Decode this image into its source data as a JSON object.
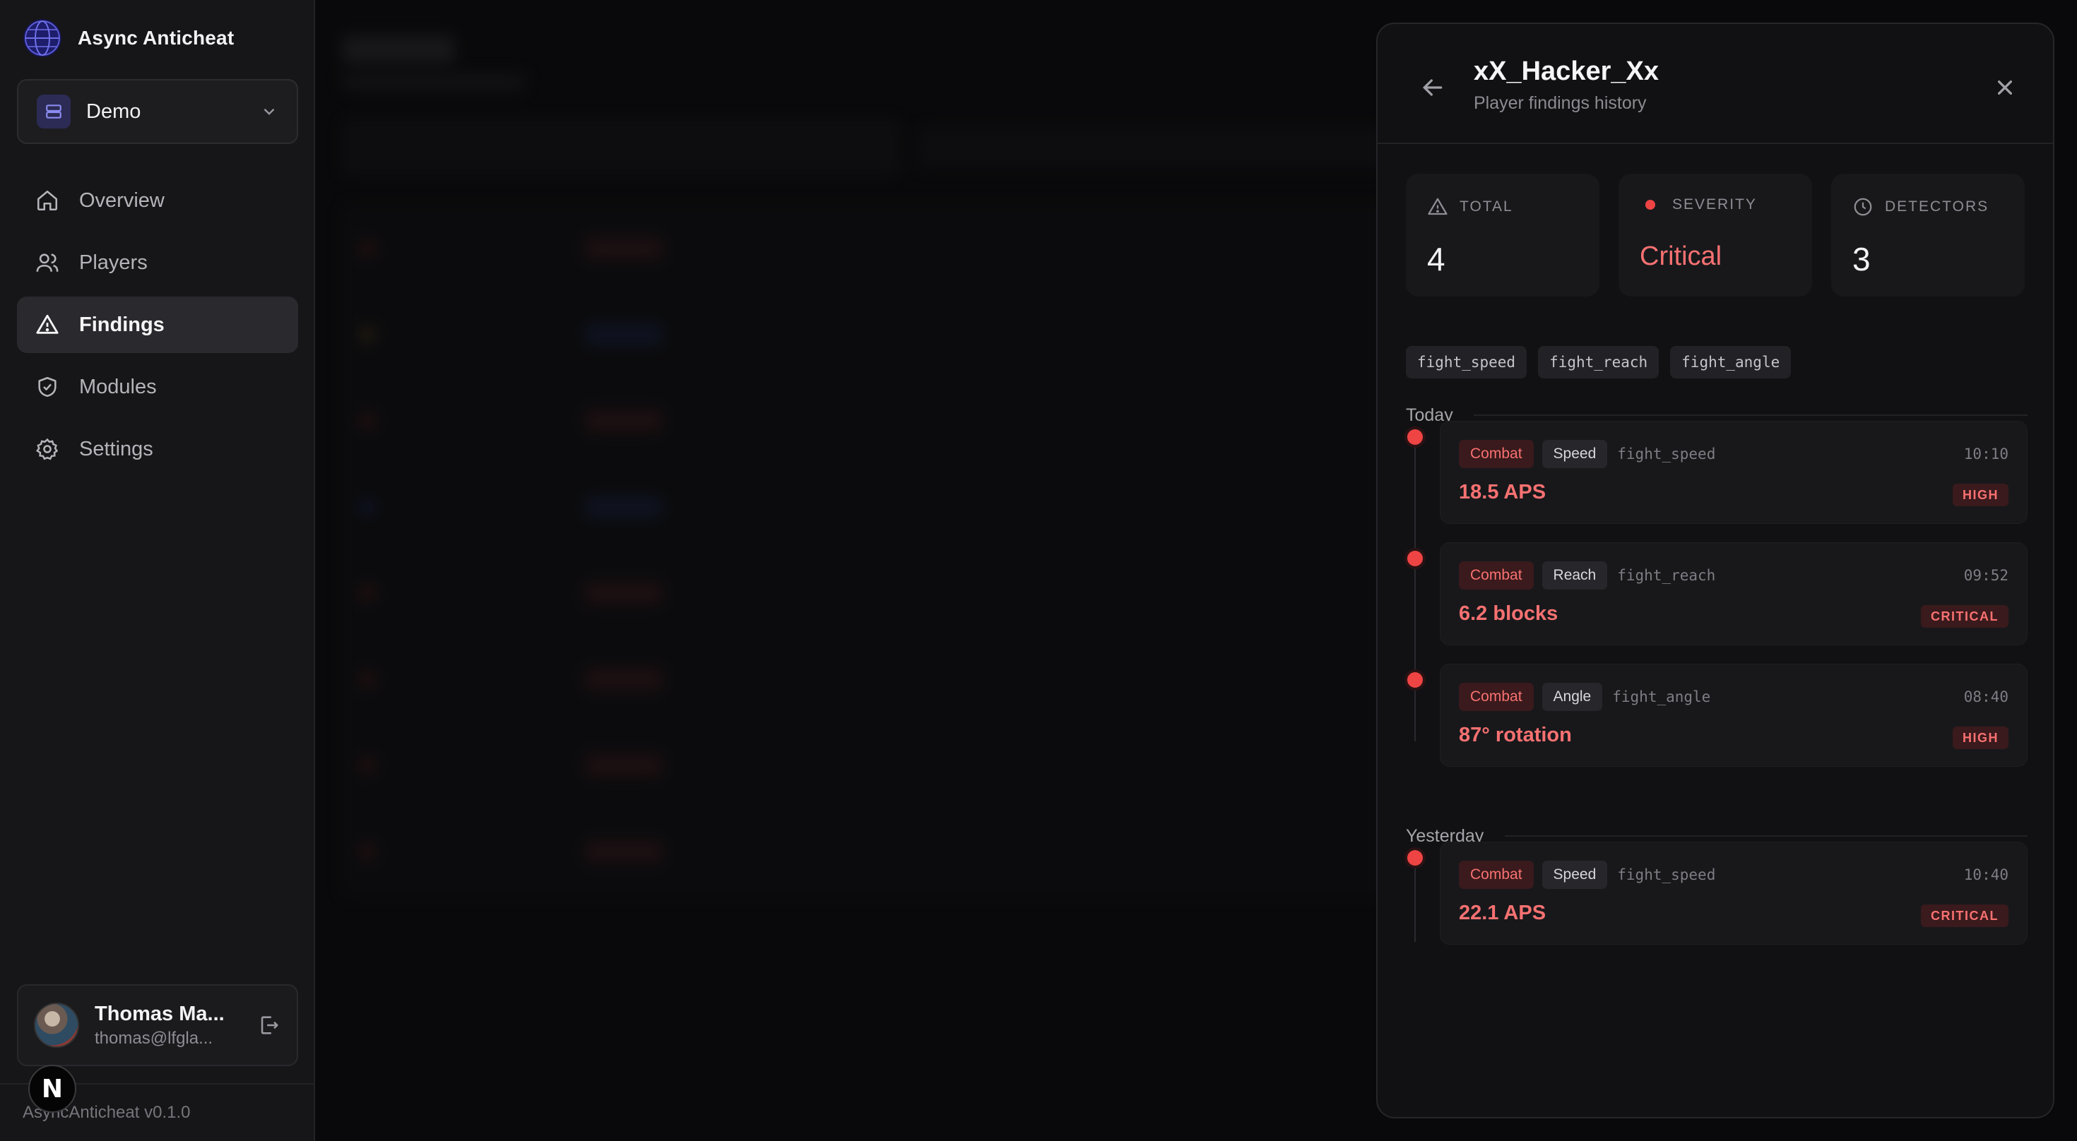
{
  "app": {
    "name": "Async Anticheat",
    "version": "AsyncAnticheat v0.1.0"
  },
  "project": {
    "name": "Demo"
  },
  "nav": [
    {
      "label": "Overview",
      "icon": "home-icon",
      "active": false
    },
    {
      "label": "Players",
      "icon": "users-icon",
      "active": false
    },
    {
      "label": "Findings",
      "icon": "alert-triangle-icon",
      "active": true
    },
    {
      "label": "Modules",
      "icon": "shield-check-icon",
      "active": false
    },
    {
      "label": "Settings",
      "icon": "gear-icon",
      "active": false
    }
  ],
  "user": {
    "name": "Thomas Ma...",
    "email": "thomas@lfgla..."
  },
  "next_badge": "N",
  "drawer": {
    "title": "xX_Hacker_Xx",
    "subtitle": "Player findings history",
    "stats": {
      "total": {
        "label": "TOTAL",
        "value": "4"
      },
      "severity": {
        "label": "SEVERITY",
        "value": "Critical"
      },
      "detectors": {
        "label": "DETECTORS",
        "value": "3"
      }
    },
    "detectors": [
      "fight_speed",
      "fight_reach",
      "fight_angle"
    ],
    "groups": {
      "today": "Today",
      "yesterday": "Yesterday"
    },
    "findings": [
      {
        "category": "Combat",
        "type": "Speed",
        "detector": "fight_speed",
        "time": "10:10",
        "value": "18.5 APS",
        "severity": "HIGH"
      },
      {
        "category": "Combat",
        "type": "Reach",
        "detector": "fight_reach",
        "time": "09:52",
        "value": "6.2 blocks",
        "severity": "CRITICAL"
      },
      {
        "category": "Combat",
        "type": "Angle",
        "detector": "fight_angle",
        "time": "08:40",
        "value": "87° rotation",
        "severity": "HIGH"
      },
      {
        "category": "Combat",
        "type": "Speed",
        "detector": "fight_speed",
        "time": "10:40",
        "value": "22.1 APS",
        "severity": "CRITICAL"
      }
    ]
  },
  "colors": {
    "accent_red": "#f87171",
    "dot_red": "#ef4444",
    "bg": "#0a0a0b",
    "panel": "#111113"
  }
}
